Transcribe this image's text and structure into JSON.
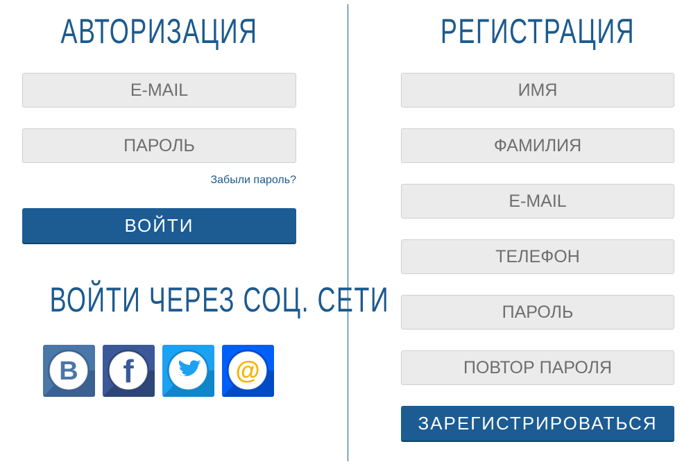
{
  "login": {
    "title": "АВТОРИЗАЦИЯ",
    "email_placeholder": "E-MAIL",
    "password_placeholder": "ПАРОЛЬ",
    "forgot_label": "Забыли пароль?",
    "submit_label": "ВОЙТИ"
  },
  "social": {
    "title": "ВОЙТИ ЧЕРЕЗ СОЦ. СЕТИ",
    "items": [
      {
        "icon": "vk-icon",
        "glyph": "B",
        "color": "#4a76a8"
      },
      {
        "icon": "facebook-icon",
        "glyph": "f",
        "color": "#3b5998"
      },
      {
        "icon": "twitter-icon",
        "glyph": "bird",
        "color": "#1da1f2"
      },
      {
        "icon": "mail-ru-icon",
        "glyph": "@",
        "color": "#005ff9"
      }
    ]
  },
  "register": {
    "title": "РЕГИСТРАЦИЯ",
    "first_name_placeholder": "ИМЯ",
    "last_name_placeholder": "ФАМИЛИЯ",
    "email_placeholder": "E-MAIL",
    "phone_placeholder": "ТЕЛЕФОН",
    "password_placeholder": "ПАРОЛЬ",
    "password_repeat_placeholder": "ПОВТОР ПАРОЛЯ",
    "submit_label": "ЗАРЕГИСТРИРОВАТЬСЯ"
  },
  "colors": {
    "brand": "#1c5a8e",
    "field_bg": "#ebebeb",
    "field_text": "#6e6e6e",
    "vk": "#4a76a8",
    "facebook": "#3b5998",
    "twitter": "#1da1f2",
    "mail_ru": "#005ff9"
  }
}
